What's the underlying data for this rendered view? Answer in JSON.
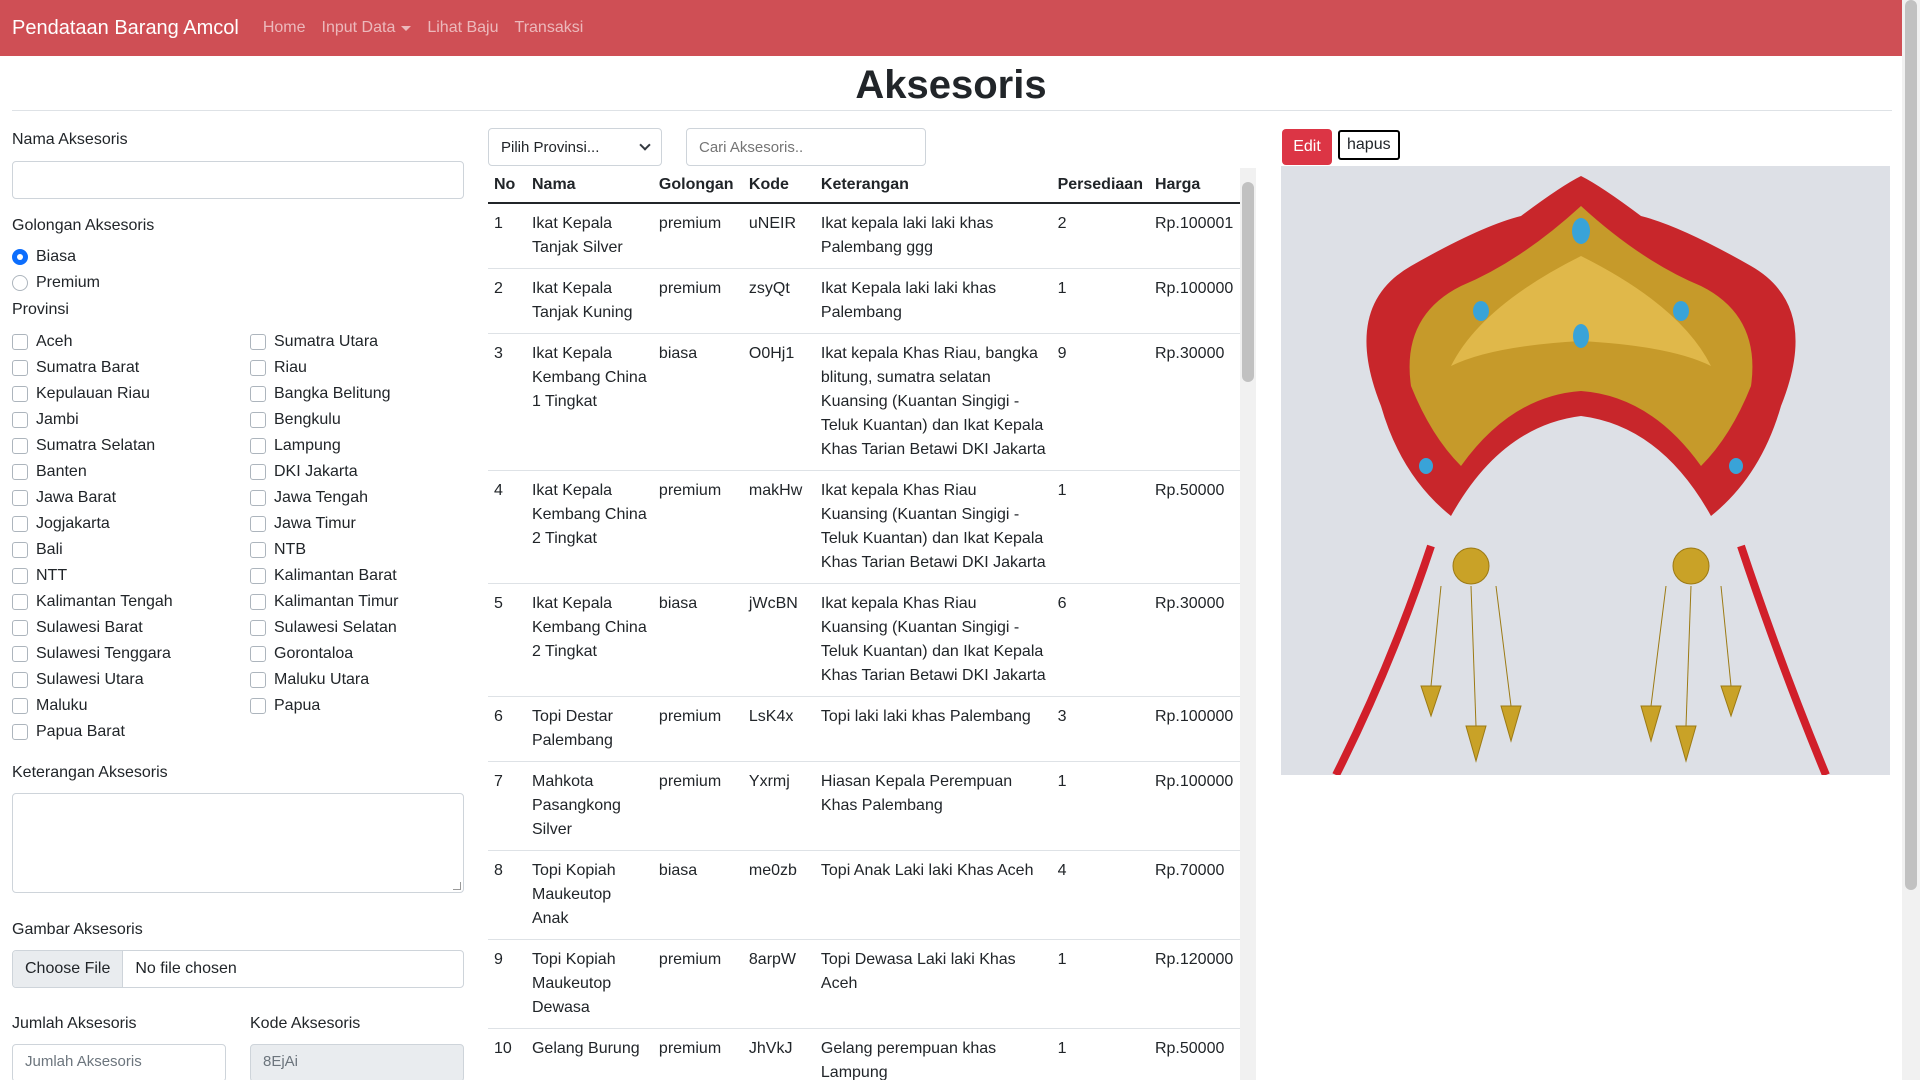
{
  "nav": {
    "brand": "Pendataan Barang Amcol",
    "links": [
      "Home",
      "Input Data",
      "Lihat Baju",
      "Transaksi"
    ]
  },
  "page": {
    "title": "Aksesoris"
  },
  "form": {
    "nama_label": "Nama Aksesoris",
    "golongan_label": "Golongan Aksesoris",
    "golongan_options": [
      "Biasa",
      "Premium"
    ],
    "golongan_selected": "Biasa",
    "provinsi_label": "Provinsi",
    "provinsi_col1": [
      "Aceh",
      "Sumatra Barat",
      "Kepulauan Riau",
      "Jambi",
      "Sumatra Selatan",
      "Banten",
      "Jawa Barat",
      "Jogjakarta",
      "Bali",
      "NTT",
      "Kalimantan Tengah",
      "Sulawesi Barat",
      "Sulawesi Tenggara",
      "Sulawesi Utara",
      "Maluku",
      "Papua Barat"
    ],
    "provinsi_col2": [
      "Sumatra Utara",
      "Riau",
      "Bangka Belitung",
      "Bengkulu",
      "Lampung",
      "DKI Jakarta",
      "Jawa Tengah",
      "Jawa Timur",
      "NTB",
      "Kalimantan Barat",
      "Kalimantan Timur",
      "Sulawesi Selatan",
      "Gorontaloa",
      "Maluku Utara",
      "Papua"
    ],
    "keterangan_label": "Keterangan Aksesoris",
    "gambar_label": "Gambar Aksesoris",
    "file_button": "Choose File",
    "file_text": "No file chosen",
    "jumlah_label": "Jumlah Aksesoris",
    "jumlah_placeholder": "Jumlah Aksesoris",
    "kode_label": "Kode Aksesoris",
    "kode_value": "8EjAi"
  },
  "filter": {
    "provinsi_select": "Pilih Provinsi...",
    "search_placeholder": "Cari Aksesoris.."
  },
  "table": {
    "headers": [
      "No",
      "Nama",
      "Golongan",
      "Kode",
      "Keterangan",
      "Persediaan",
      "Harga"
    ],
    "rows": [
      [
        "1",
        "Ikat Kepala Tanjak Silver",
        "premium",
        "uNEIR",
        "Ikat kepala laki laki khas Palembang ggg",
        "2",
        "Rp.100001"
      ],
      [
        "2",
        "Ikat Kepala Tanjak Kuning",
        "premium",
        "zsyQt",
        "Ikat Kepala laki laki khas Palembang",
        "1",
        "Rp.100000"
      ],
      [
        "3",
        "Ikat Kepala Kembang China 1 Tingkat",
        "biasa",
        "O0Hj1",
        "Ikat kepala Khas Riau, bangka blitung, sumatra selatan Kuansing (Kuantan Singigi - Teluk Kuantan) dan Ikat Kepala Khas Tarian Betawi DKI Jakarta",
        "9",
        "Rp.30000"
      ],
      [
        "4",
        "Ikat Kepala Kembang China 2 Tingkat",
        "premium",
        "makHw",
        "Ikat kepala Khas Riau Kuansing (Kuantan Singigi -Teluk Kuantan) dan Ikat Kepala Khas Tarian Betawi DKI Jakarta",
        "1",
        "Rp.50000"
      ],
      [
        "5",
        "Ikat Kepala Kembang China 2 Tingkat",
        "biasa",
        "jWcBN",
        "Ikat kepala Khas Riau Kuansing (Kuantan Singigi -Teluk Kuantan) dan Ikat Kepala Khas Tarian Betawi DKI Jakarta",
        "6",
        "Rp.30000"
      ],
      [
        "6",
        "Topi Destar Palembang",
        "premium",
        "LsK4x",
        "Topi laki laki khas Palembang",
        "3",
        "Rp.100000"
      ],
      [
        "7",
        "Mahkota Pasangkong Silver",
        "premium",
        "Yxrmj",
        "Hiasan Kepala Perempuan Khas Palembang",
        "1",
        "Rp.100000"
      ],
      [
        "8",
        "Topi Kopiah Maukeutop Anak",
        "biasa",
        "me0zb",
        "Topi Anak Laki laki Khas Aceh",
        "4",
        "Rp.70000"
      ],
      [
        "9",
        "Topi Kopiah Maukeutop Dewasa",
        "premium",
        "8arpW",
        "Topi Dewasa Laki laki Khas Aceh",
        "1",
        "Rp.120000"
      ],
      [
        "10",
        "Gelang Burung",
        "premium",
        "JhVkJ",
        "Gelang perempuan khas Lampung",
        "1",
        "Rp.50000"
      ]
    ]
  },
  "detail": {
    "edit_label": "Edit",
    "hapus_label": "hapus"
  },
  "colors": {
    "navbar": "#cf4f55",
    "edit_button": "#dc3545",
    "radio_checked": "#0d6efd"
  }
}
